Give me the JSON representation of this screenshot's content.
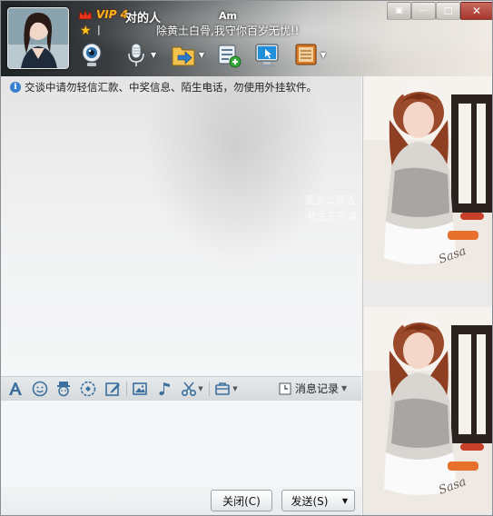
{
  "header": {
    "vip_label": "VIP 4",
    "nickname": "对的人",
    "status_text": "Am",
    "signature": "除黄土白骨,我守你百岁无忧!!",
    "toolbar_icons": [
      "video-call-icon",
      "voice-call-icon",
      "send-file-icon",
      "add-app-icon",
      "remote-assist-icon",
      "app-box-icon"
    ]
  },
  "window_controls": {
    "pin": "▣",
    "minimize": "—",
    "maximize": "☐",
    "close": "✕"
  },
  "chat": {
    "notice": "交谈中请勿轻信汇款、中奖信息、陌生电话，勿使用外挂软件。",
    "ghost_line_1": "爱多么爱活",
    "ghost_line_2": "背生无所谓"
  },
  "toolbar": {
    "history_label": "消息记录",
    "icons": [
      "font-icon",
      "emoji-icon",
      "magic-face-icon",
      "shake-icon",
      "doodle-icon",
      "image-icon",
      "music-icon",
      "screenshot-icon",
      "app-icon"
    ]
  },
  "footer": {
    "close_label": "关闭(C)",
    "send_label": "发送(S)"
  },
  "colors": {
    "vip": "#ffb21a",
    "toolbar_bg": "#dde0e3",
    "button_border": "#9ba3aa"
  }
}
